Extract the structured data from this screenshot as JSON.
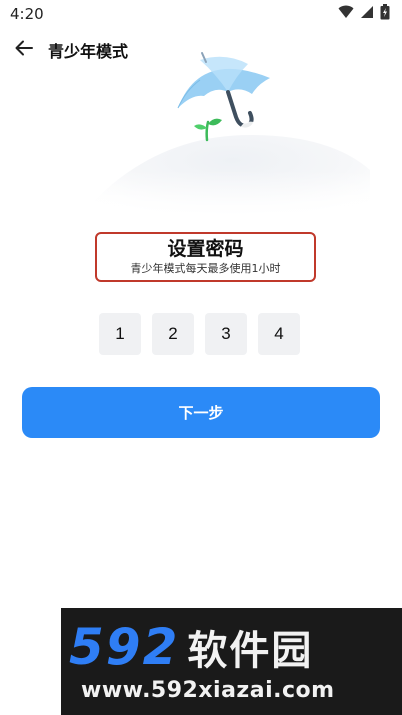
{
  "status_bar": {
    "time": "4:20",
    "icons": [
      "wifi-icon",
      "signal-icon",
      "battery-icon"
    ]
  },
  "header": {
    "title": "青少年模式",
    "back_icon": "arrow-left-icon"
  },
  "content": {
    "title": "设置密码",
    "subtitle": "青少年模式每天最多使用1小时",
    "password_digits": [
      "1",
      "2",
      "3",
      "4"
    ],
    "next_label": "下一步"
  },
  "watermark": {
    "brand_number": "592",
    "brand_text": "软件园",
    "url": "www.592xiazai.com"
  },
  "colors": {
    "accent": "#2b8af7",
    "highlight_border": "#c0392b",
    "input_bg": "#f0f1f3",
    "umbrella": "#8ec9f2",
    "sprout": "#3dbb5a"
  }
}
